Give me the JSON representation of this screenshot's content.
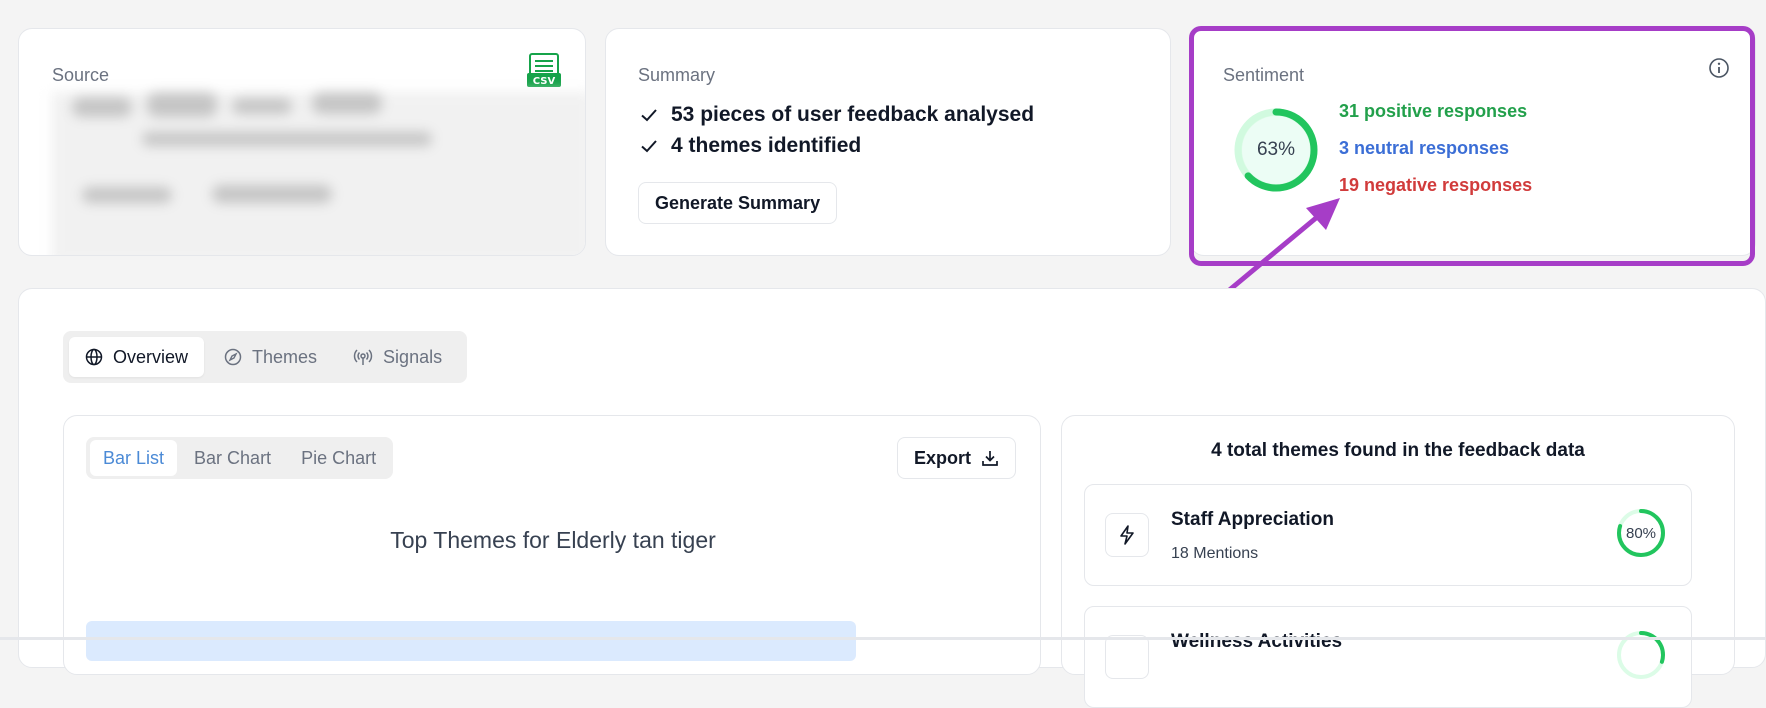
{
  "source": {
    "label": "Source",
    "file_icon": "csv-file-icon",
    "file_badge": "CSV"
  },
  "summary": {
    "label": "Summary",
    "items": [
      "53 pieces of user feedback analysed",
      "4 themes identified"
    ],
    "button_label": "Generate Summary"
  },
  "sentiment": {
    "label": "Sentiment",
    "percent_label": "63%",
    "positive_fraction": 0.63,
    "positive": "31 positive responses",
    "neutral": "3 neutral responses",
    "negative": "19 negative responses",
    "colors": {
      "positive": "#22a04b",
      "neutral": "#3b6ed6",
      "negative": "#d13b3b",
      "ring": "#22c55e"
    }
  },
  "annotation": {
    "highlight_color": "#a63dc7"
  },
  "tabs": [
    {
      "label": "Overview",
      "icon": "globe-icon",
      "active": true
    },
    {
      "label": "Themes",
      "icon": "compass-icon",
      "active": false
    },
    {
      "label": "Signals",
      "icon": "radio-signal-icon",
      "active": false
    }
  ],
  "view_tabs": [
    {
      "label": "Bar List",
      "active": true
    },
    {
      "label": "Bar Chart",
      "active": false
    },
    {
      "label": "Pie Chart",
      "active": false
    }
  ],
  "export_label": "Export",
  "chart_title": "Top Themes for Elderly tan tiger",
  "themes_panel": {
    "title": "4 total themes found in the feedback data",
    "items": [
      {
        "name": "Staff Appreciation",
        "mentions": "18 Mentions",
        "percent_label": "80%",
        "fraction": 0.8,
        "icon": "lightning-icon"
      },
      {
        "name": "Wellness Activities",
        "mentions": "",
        "percent_label": "",
        "fraction": 0.3,
        "icon": "lightning-icon"
      }
    ]
  }
}
